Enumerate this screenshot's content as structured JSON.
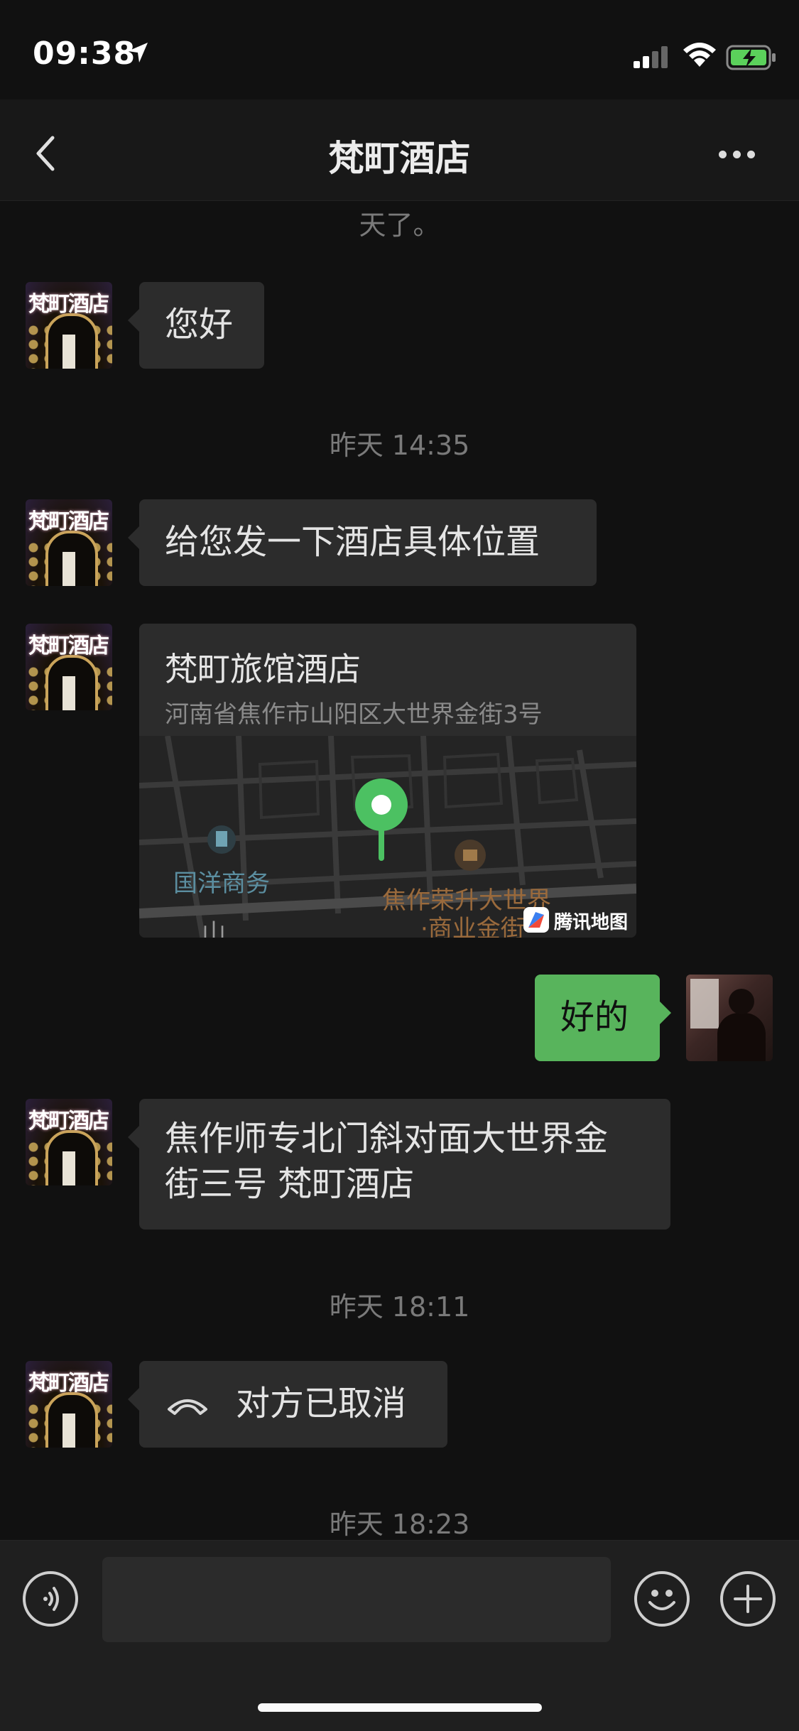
{
  "status_bar": {
    "time": "09:38"
  },
  "header": {
    "title": "梵町酒店"
  },
  "messages": {
    "top_partial": "天了。",
    "m1": "您好",
    "ts1": "昨天 14:35",
    "m2": "给您发一下酒店具体位置",
    "location": {
      "name": "梵町旅馆酒店",
      "address": "河南省焦作市山阳区大世界金街3号",
      "map_label_1": "国洋商务",
      "map_label_2": "焦作荣升大世界",
      "map_label_3": "·商业金街",
      "map_label_4": "山",
      "map_brand": "腾讯地图"
    },
    "m3": "好的",
    "m4_line1": "焦作师专北门斜对面大世界金",
    "m4_line2": "街三号 梵町酒店",
    "ts2": "昨天 18:11",
    "call": "对方已取消",
    "ts3": "昨天 18:23"
  },
  "colors": {
    "accent_green": "#58b45c",
    "bubble_dark": "#2c2c2c",
    "background": "#111111"
  },
  "icons": [
    "back-chevron-icon",
    "more-icon",
    "voice-icon",
    "emoji-icon",
    "plus-icon",
    "hangup-icon",
    "map-pin-icon"
  ]
}
